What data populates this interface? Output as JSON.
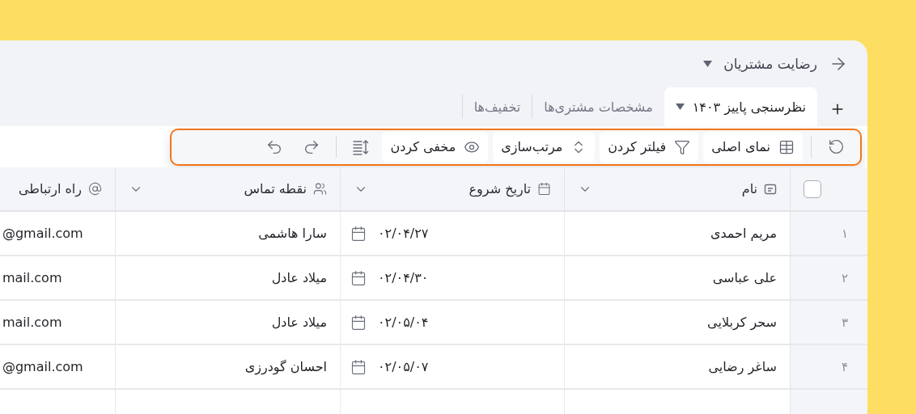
{
  "header": {
    "title": "رضایت مشتریان"
  },
  "tabs": [
    {
      "label": "نظرسنجی پاییز ۱۴۰۳",
      "selected": true
    },
    {
      "label": "مشخصات مشتری‌ها",
      "selected": false
    },
    {
      "label": "تخفیف‌ها",
      "selected": false
    }
  ],
  "toolbar": {
    "buttons": [
      {
        "label": "نمای اصلی",
        "kind": "table"
      },
      {
        "label": "فیلتر کردن",
        "kind": "filter"
      },
      {
        "label": "مرتب‌سازی",
        "kind": "sort"
      },
      {
        "label": "مخفی کردن",
        "kind": "hide"
      }
    ]
  },
  "table": {
    "select_all_checked": false,
    "columns": [
      {
        "label": "نام",
        "kind": "text"
      },
      {
        "label": "تاریخ شروع",
        "kind": "date"
      },
      {
        "label": "نقطه تماس",
        "kind": "person"
      },
      {
        "label": "راه ارتباطی",
        "kind": "email"
      }
    ],
    "rows": [
      {
        "number": "۱",
        "cells": [
          "مریم احمدی",
          "۰۲/۰۴/۲۷",
          "سارا هاشمی",
          "@gmail.com"
        ]
      },
      {
        "number": "۲",
        "cells": [
          "علی عباسی",
          "۰۲/۰۴/۳۰",
          "میلاد عادل",
          "mail.com"
        ]
      },
      {
        "number": "۳",
        "cells": [
          "سحر کربلایی",
          "۰۲/۰۵/۰۴",
          "میلاد عادل",
          "mail.com"
        ]
      },
      {
        "number": "۴",
        "cells": [
          "ساغر رضایی",
          "۰۲/۰۵/۰۷",
          "احسان گودرزی",
          "@gmail.com"
        ]
      }
    ]
  }
}
